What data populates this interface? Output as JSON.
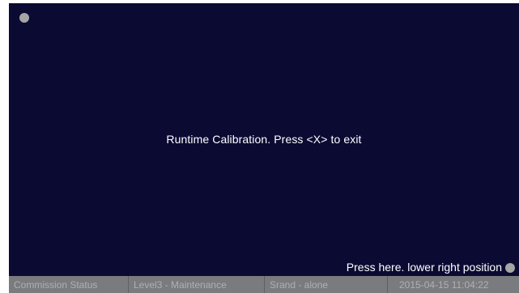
{
  "calibration": {
    "message": "Runtime Calibration. Press <X> to exit",
    "lower_right_prompt": "Press here. lower right position",
    "target_icon": "calibration-target-dot"
  },
  "status_bar": {
    "commission_status": "Commission Status",
    "access_level": "Level3 - Maintenance",
    "mode": "Srand - alone",
    "datetime": "2015-04-15 11:04:22"
  },
  "colors": {
    "screen_background": "#0b0a33",
    "status_bar_background": "#7a7b7e",
    "target_dot": "#a5a5a5"
  }
}
